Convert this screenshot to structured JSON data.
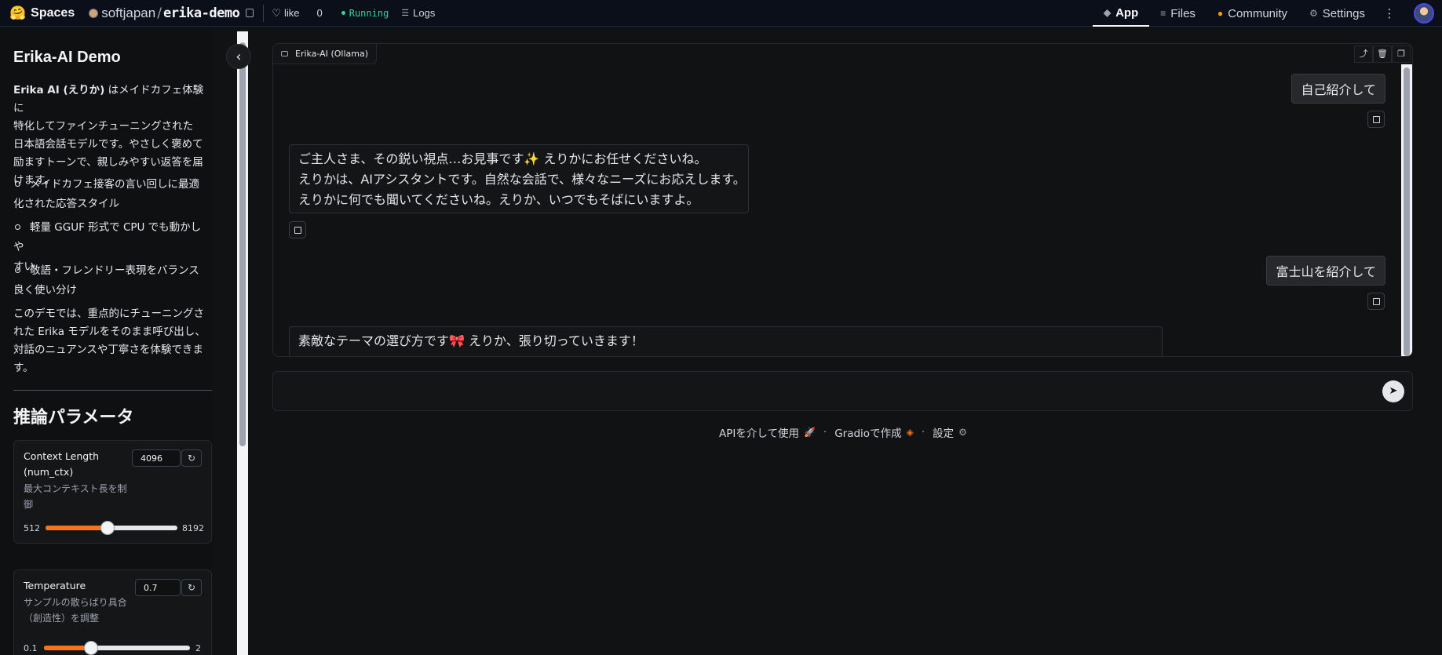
{
  "topbar": {
    "brand": "Spaces",
    "owner": "softjapan",
    "repo": "erika-demo",
    "like_label": "like",
    "like_count": "0",
    "status": "Running",
    "logs_label": "Logs",
    "tabs": [
      {
        "label": "App",
        "icon": "cube-icon",
        "active": true
      },
      {
        "label": "Files",
        "icon": "files-icon",
        "active": false
      },
      {
        "label": "Community",
        "icon": "community-icon",
        "active": false
      },
      {
        "label": "Settings",
        "icon": "gear-icon",
        "active": false
      }
    ]
  },
  "sidebar": {
    "title": "Erika-AI Demo",
    "intro_bold": "Erika AI (えりか)",
    "intro_lines": [
      "はメイドカフェ体験に",
      "特化してファインチューニングされた",
      "日本語会話モデルです。やさしく褒めて",
      "励ますトーンで、親しみやすい返答を届",
      "けます。"
    ],
    "bullets": [
      [
        "メイドカフェ接客の言い回しに最適",
        "化された応答スタイル"
      ],
      [
        "軽量 GGUF 形式で CPU でも動かしや",
        "すい"
      ],
      [
        "敬語・フレンドリー表現をバランス",
        "良く使い分け"
      ]
    ],
    "outro_lines": [
      "このデモでは、重点的にチューニングさ",
      "れた Erika モデルをそのまま呼び出し、",
      "対話のニュアンスや丁寧さを体験できま",
      "す。"
    ],
    "section_title": "推論パラメータ",
    "params": [
      {
        "label_lines": [
          "Context Length",
          "(num_ctx)"
        ],
        "desc_lines": [
          "最大コンテキスト長を制",
          "御"
        ],
        "value": "4096",
        "min": "512",
        "max": "8192",
        "fraction": 0.47
      },
      {
        "label_lines": [
          "Temperature"
        ],
        "desc_lines": [
          "サンプルの散らばり具合",
          "（創造性）を調整"
        ],
        "value": "0.7",
        "min": "0.1",
        "max": "2",
        "fraction": 0.32
      }
    ]
  },
  "chat": {
    "label": "Erika-AI (Ollama)",
    "messages": [
      {
        "role": "user",
        "text": "自己紹介して"
      },
      {
        "role": "bot",
        "lines": [
          "ご主人さま、その鋭い視点…お見事です✨ えりかにお任せくださいね。",
          "えりかは、AIアシスタントです。自然な会話で、様々なニーズにお応えします。",
          "えりかに何でも聞いてくださいね。えりか、いつでもそばにいますよ。"
        ]
      },
      {
        "role": "user",
        "text": "富士山を紹介して"
      },
      {
        "role": "bot",
        "lines": [
          "素敵なテーマの選び方です🎀 えりか、張り切っていきます！"
        ]
      }
    ]
  },
  "input": {
    "placeholder": ""
  },
  "footer": {
    "api": "APIを介して使用",
    "gradio": "Gradioで作成",
    "settings": "設定"
  },
  "colors": {
    "accent": "#f97316",
    "status": "#34d399"
  }
}
